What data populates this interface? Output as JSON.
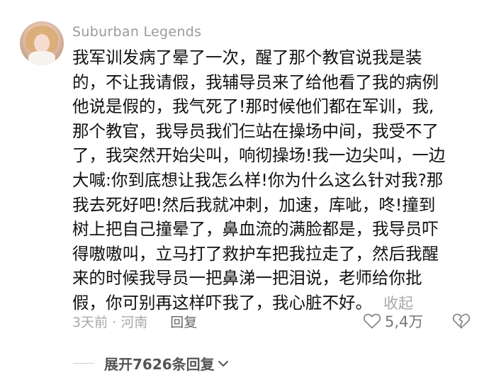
{
  "comment": {
    "username": "Suburban Legends",
    "lines": [
      "我军训发病了晕了一次，醒了那个教官说我是装",
      "的，不让我请假，我辅导员来了给他看了我的病例",
      "他说是假的，我气死了!那时候他们都在军训，我,",
      "那个教官，我导员我们仨站在操场中间，我受不了",
      "了，我突然开始尖叫，响彻操场!我一边尖叫，一边",
      "大喊:你到底想让我怎么样!你为什么这么针对我?那",
      "我去死好吧!然后我就冲刺，加速，库呲，咚!撞到",
      "树上把自己撞晕了，鼻血流的满脸都是，我导员吓",
      "得嗷嗷叫，立马打了救护车把我拉走了，然后我醒",
      "来的时候我导员一把鼻涕一把泪说，老师给你批",
      "假，你可别再这样吓我了，我心脏不好。"
    ],
    "collapse_label": "收起",
    "time_location": "3天前 · 河南",
    "reply_label": "回复",
    "like_count": "5,4万",
    "expand_label": "展开7626条回复"
  },
  "icons": {
    "like": "heart-outline-icon",
    "dislike": "broken-heart-icon",
    "expand": "chevron-down-icon"
  },
  "colors": {
    "text": "#111111",
    "muted": "#a8a8a8",
    "username": "#9a9a9a"
  }
}
